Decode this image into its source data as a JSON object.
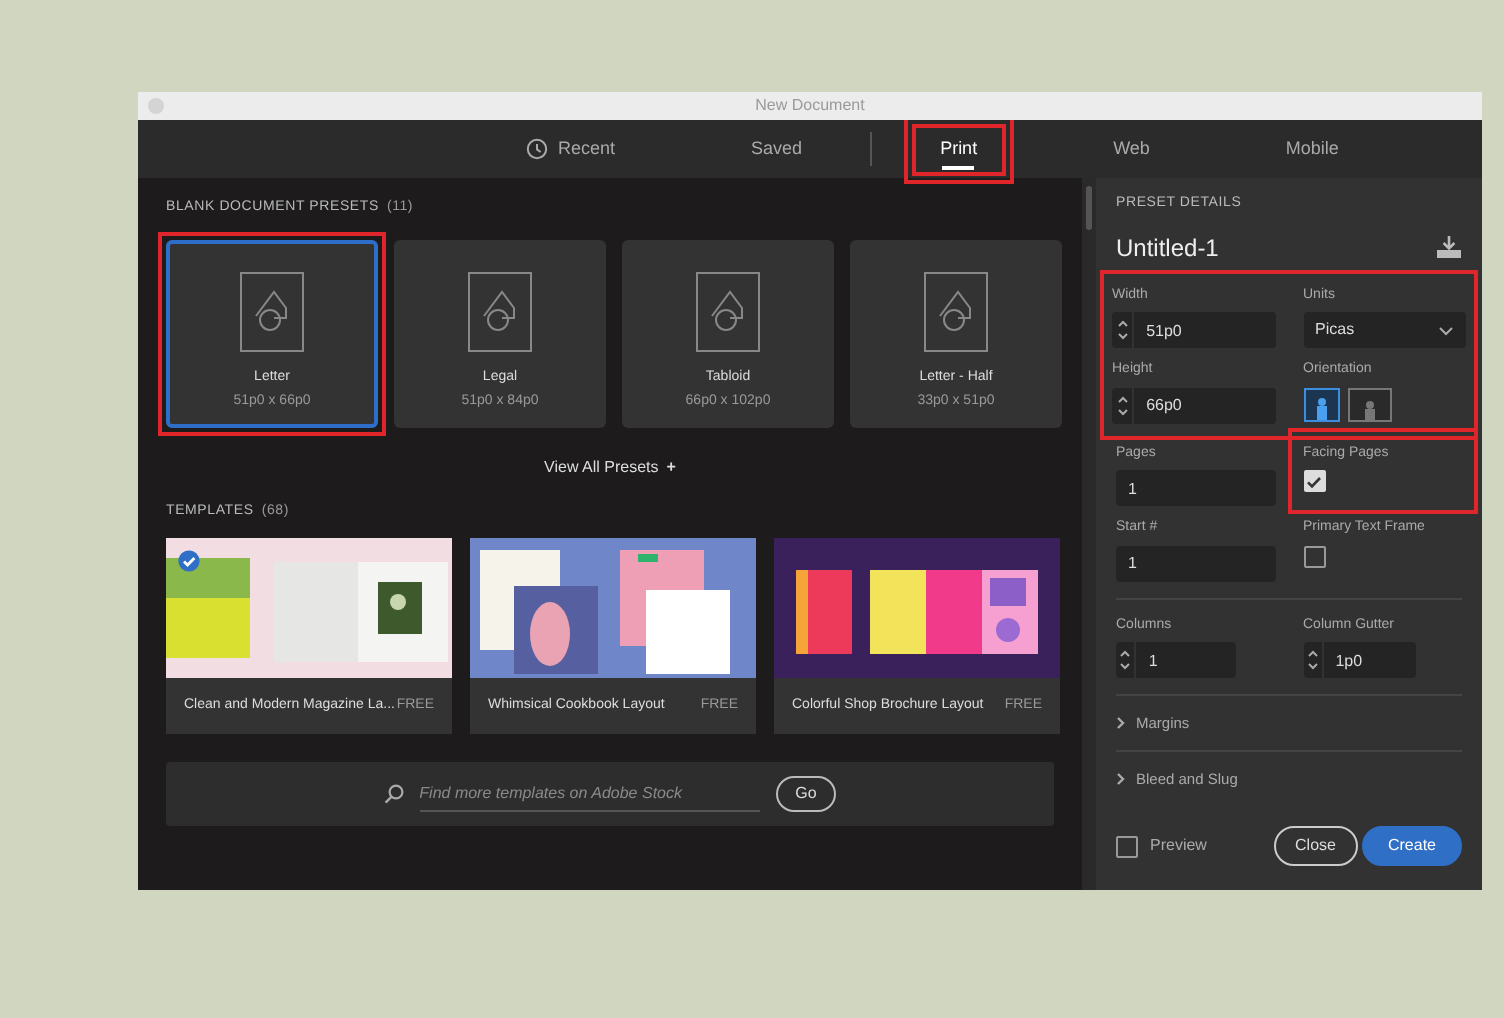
{
  "window": {
    "title": "New Document"
  },
  "tabs": [
    {
      "label": "Recent",
      "kind": "recent",
      "selected": false,
      "highlighted": false
    },
    {
      "label": "Saved",
      "kind": "plain",
      "selected": false,
      "highlighted": false
    },
    {
      "kind": "divider"
    },
    {
      "label": "Print",
      "kind": "plain",
      "selected": true,
      "highlighted": true
    },
    {
      "label": "Web",
      "kind": "plain",
      "selected": false,
      "highlighted": false
    },
    {
      "label": "Mobile",
      "kind": "plain",
      "selected": false,
      "highlighted": false
    }
  ],
  "presets": {
    "title": "BLANK DOCUMENT PRESETS",
    "count": "(11)",
    "view_all": "View All Presets",
    "view_all_icon": "+",
    "items": [
      {
        "name": "Letter",
        "size": "51p0 x 66p0",
        "selected": true,
        "highlighted": true
      },
      {
        "name": "Legal",
        "size": "51p0 x 84p0",
        "selected": false,
        "highlighted": false
      },
      {
        "name": "Tabloid",
        "size": "66p0 x 102p0",
        "selected": false,
        "highlighted": false
      },
      {
        "name": "Letter - Half",
        "size": "33p0 x 51p0",
        "selected": false,
        "highlighted": false
      }
    ]
  },
  "templates": {
    "title": "TEMPLATES",
    "count": "(68)",
    "items": [
      {
        "kind": "picture",
        "name": "Clean and Modern Magazine La...",
        "price": "FREE",
        "selected": true
      },
      {
        "kind": "picture",
        "name": "Whimsical Cookbook Layout",
        "price": "FREE",
        "selected": false
      },
      {
        "kind": "picture",
        "name": "Colorful Shop Brochure Layout",
        "price": "FREE",
        "selected": false
      }
    ]
  },
  "search": {
    "placeholder": "Find more templates on Adobe Stock",
    "button": "Go"
  },
  "details": {
    "title": "PRESET DETAILS",
    "name": "Untitled-1",
    "size_group_highlighted": true,
    "width": {
      "label": "Width",
      "value": "51p0"
    },
    "units": {
      "label": "Units",
      "value": "Picas"
    },
    "height": {
      "label": "Height",
      "value": "66p0"
    },
    "orientation": {
      "label": "Orientation",
      "options": [
        {
          "kind": "portrait",
          "selected": true
        },
        {
          "kind": "landscape",
          "selected": false
        }
      ]
    },
    "pages": {
      "label": "Pages",
      "value": "1"
    },
    "facing_pages": {
      "label": "Facing Pages",
      "checked": true,
      "highlighted": true
    },
    "start": {
      "label": "Start #",
      "value": "1"
    },
    "primary_text_frame": {
      "label": "Primary Text Frame",
      "checked": false
    },
    "columns": {
      "label": "Columns",
      "value": "1"
    },
    "column_gutter": {
      "label": "Column Gutter",
      "value": "1p0"
    },
    "sections": [
      {
        "label": "Margins",
        "expanded": false
      },
      {
        "label": "Bleed and Slug",
        "expanded": false
      }
    ],
    "preview": {
      "label": "Preview",
      "checked": false
    },
    "buttons": [
      {
        "label": "Close",
        "kind": "secondary"
      },
      {
        "label": "Create",
        "kind": "primary"
      }
    ]
  }
}
